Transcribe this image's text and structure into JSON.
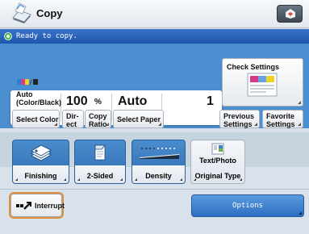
{
  "header": {
    "title": "Copy",
    "app_icon": "copy-app-icon",
    "home_icon": "home-menu-icon"
  },
  "status": {
    "text": "Ready to copy.",
    "icon": "ready-status-icon"
  },
  "settings": {
    "color_mode_line1": "Auto",
    "color_mode_line2": "(Color/Black)",
    "copy_ratio_value": "100",
    "copy_ratio_unit": "%",
    "paper_value": "Auto",
    "copies_value": "1"
  },
  "buttons": {
    "select_color": "Select Color",
    "direct_line1": "Dir-",
    "direct_line2": "ect",
    "copy_ratio_line1": "Copy",
    "copy_ratio_line2": "Ratio",
    "select_paper": "Select Paper",
    "check_settings": "Check Settings",
    "previous_line1": "Previous",
    "previous_line2": "Settings",
    "favorite_line1": "Favorite",
    "favorite_line2": "Settings"
  },
  "functions": [
    {
      "label": "Finishing",
      "icon": "finishing-icon"
    },
    {
      "label": "2-Sided",
      "icon": "two-sided-icon"
    },
    {
      "label": "Density",
      "icon": "density-icon"
    },
    {
      "label_top": "Text/Photo",
      "label": "Original Type",
      "icon": "original-type-icon"
    }
  ],
  "footer": {
    "interrupt": "Interrupt",
    "options": "Options"
  },
  "colors": {
    "status_blue": "#1e55ad",
    "panel_blue": "#4b8fd0",
    "interrupt_highlight": "#e0903a"
  }
}
